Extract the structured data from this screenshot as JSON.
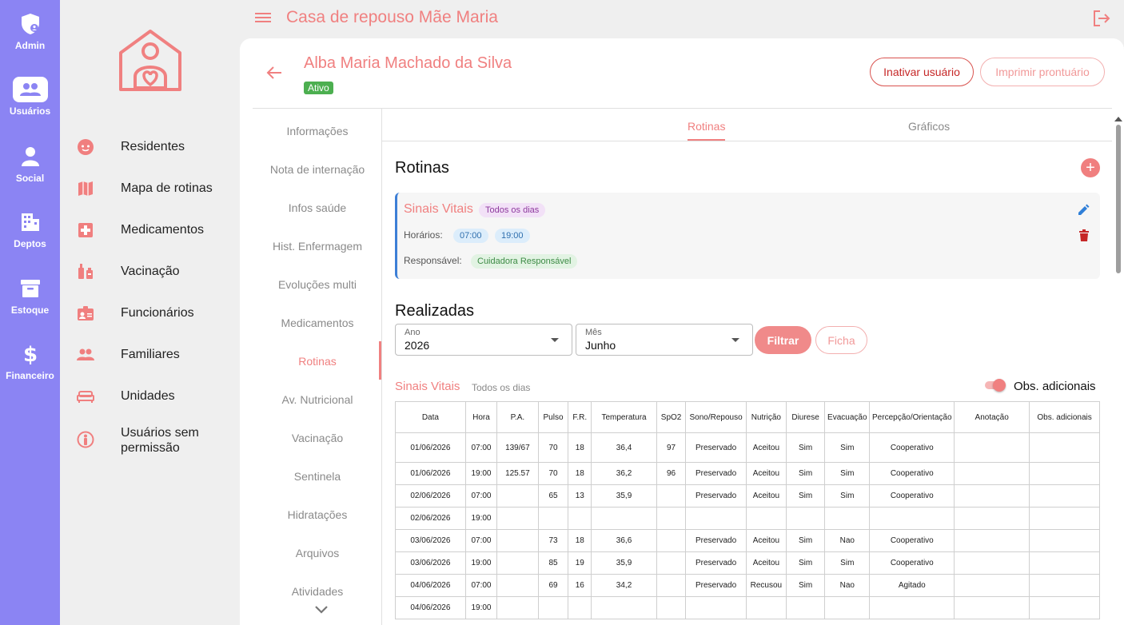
{
  "app": {
    "title": "Casa de repouso Mãe Maria"
  },
  "rail": [
    {
      "label": "Admin",
      "icon": "admin-shield-icon"
    },
    {
      "label": "Usuários",
      "icon": "users-icon",
      "active": true
    },
    {
      "label": "Social",
      "icon": "person-icon"
    },
    {
      "label": "Deptos",
      "icon": "building-icon"
    },
    {
      "label": "Estoque",
      "icon": "archive-box-icon"
    },
    {
      "label": "Financeiro",
      "icon": "dollar-icon"
    }
  ],
  "nav": [
    {
      "label": "Residentes",
      "icon": "face-icon"
    },
    {
      "label": "Mapa de rotinas",
      "icon": "map-icon"
    },
    {
      "label": "Medicamentos",
      "icon": "medical-cross-icon"
    },
    {
      "label": "Vacinação",
      "icon": "syringe-icon"
    },
    {
      "label": "Funcionários",
      "icon": "badge-icon"
    },
    {
      "label": "Familiares",
      "icon": "people-icon"
    },
    {
      "label": "Unidades",
      "icon": "bed-icon"
    },
    {
      "label": "Usuários sem permissão",
      "icon": "person-circle-icon"
    }
  ],
  "patient": {
    "name": "Alba Maria Machado da Silva",
    "status": "Ativo",
    "btn_inativar": "Inativar usuário",
    "btn_imprimir": "Imprimir prontuário"
  },
  "sidemenu": [
    "Informações",
    "Nota de internação",
    "Infos saúde",
    "Hist. Enfermagem",
    "Evoluções multi",
    "Medicamentos",
    "Rotinas",
    "Av. Nutricional",
    "Vacinação",
    "Sentinela",
    "Hidratações",
    "Arquivos",
    "Atividades"
  ],
  "tabs": {
    "rotinas": "Rotinas",
    "graficos": "Gráficos"
  },
  "rotinas": {
    "title": "Rotinas",
    "card": {
      "title": "Sinais Vitais",
      "frequency": "Todos os dias",
      "horarios_label": "Horários:",
      "horarios": [
        "07:00",
        "19:00"
      ],
      "responsavel_label": "Responsável:",
      "responsavel": "Cuidadora Responsável"
    }
  },
  "realizadas": {
    "title": "Realizadas",
    "ano_label": "Ano",
    "ano_value": "2026",
    "mes_label": "Mês",
    "mes_value": "Junho",
    "btn_filtrar": "Filtrar",
    "btn_ficha": "Ficha",
    "subtitle": "Sinais Vitais",
    "subtitle_chip": "Todos os dias",
    "toggle_label": "Obs. adicionais"
  },
  "table": {
    "headers": [
      "Data",
      "Hora",
      "P.A.",
      "Pulso",
      "F.R.",
      "Temperatura",
      "SpO2",
      "Sono/Repouso",
      "Nutrição",
      "Diurese",
      "Evacuação",
      "Percepção/Orientação",
      "Anotação",
      "Obs. adicionais"
    ],
    "rows": [
      [
        "01/06/2026",
        "07:00",
        "139/67",
        "70",
        "18",
        "36,4",
        "97",
        "Preservado",
        "Aceitou",
        "Sim",
        "Sim",
        "Cooperativo",
        "",
        ""
      ],
      [
        "01/06/2026",
        "19:00",
        "125.57",
        "70",
        "18",
        "36,2",
        "96",
        "Preservado",
        "Aceitou",
        "Sim",
        "Sim",
        "Cooperativo",
        "",
        ""
      ],
      [
        "02/06/2026",
        "07:00",
        "",
        "65",
        "13",
        "35,9",
        "",
        "Preservado",
        "Aceitou",
        "Sim",
        "Sim",
        "Cooperativo",
        "",
        ""
      ],
      [
        "02/06/2026",
        "19:00",
        "",
        "",
        "",
        "",
        "",
        "",
        "",
        "",
        "",
        "",
        "",
        ""
      ],
      [
        "03/06/2026",
        "07:00",
        "",
        "73",
        "18",
        "36,6",
        "",
        "Preservado",
        "Aceitou",
        "Sim",
        "Nao",
        "Cooperativo",
        "",
        ""
      ],
      [
        "03/06/2026",
        "19:00",
        "",
        "85",
        "19",
        "35,9",
        "",
        "Preservado",
        "Aceitou",
        "Sim",
        "Sim",
        "Cooperativo",
        "",
        ""
      ],
      [
        "04/06/2026",
        "07:00",
        "",
        "69",
        "16",
        "34,2",
        "",
        "Preservado",
        "Recusou",
        "Sim",
        "Nao",
        "Agitado",
        "",
        ""
      ],
      [
        "04/06/2026",
        "19:00",
        "",
        "",
        "",
        "",
        "",
        "",
        "",
        "",
        "",
        "",
        "",
        ""
      ]
    ]
  },
  "colors": {
    "accent": "#f08080",
    "rail": "#8b84f3",
    "status_active": "#4caf50",
    "card_border": "#3d7fd6"
  }
}
